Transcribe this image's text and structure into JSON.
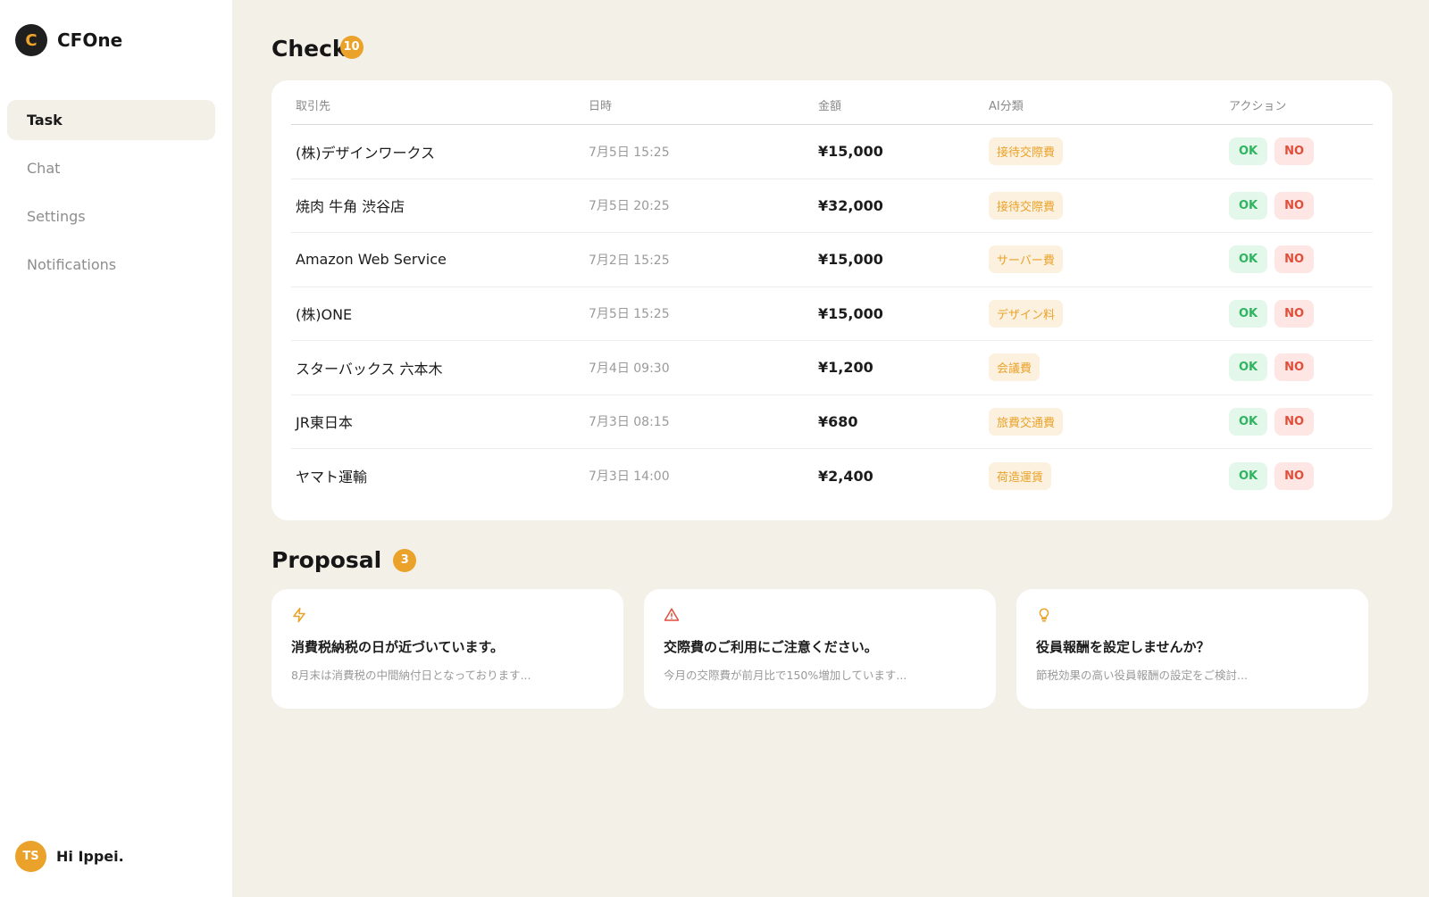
{
  "brand": {
    "logo_letter": "C",
    "name": "CFOne"
  },
  "nav": {
    "items": [
      {
        "label": "Task",
        "active": true
      },
      {
        "label": "Chat",
        "active": false
      },
      {
        "label": "Settings",
        "active": false
      },
      {
        "label": "Notifications",
        "active": false
      }
    ]
  },
  "user": {
    "initials": "TS",
    "greeting": "Hi Ippei."
  },
  "check": {
    "title": "Check",
    "count": "10",
    "columns": {
      "partner": "取引先",
      "datetime": "日時",
      "amount": "金額",
      "ai_category": "AI分類",
      "action": "アクション"
    },
    "ok_label": "OK",
    "no_label": "NO",
    "rows": [
      {
        "partner": "(株)デザインワークス",
        "datetime": "7月5日 15:25",
        "amount": "¥15,000",
        "category": "接待交際費"
      },
      {
        "partner": "焼肉 牛角 渋谷店",
        "datetime": "7月5日 20:25",
        "amount": "¥32,000",
        "category": "接待交際費"
      },
      {
        "partner": "Amazon Web Service",
        "datetime": "7月2日 15:25",
        "amount": "¥15,000",
        "category": "サーバー費"
      },
      {
        "partner": "(株)ONE",
        "datetime": "7月5日 15:25",
        "amount": "¥15,000",
        "category": "デザイン料"
      },
      {
        "partner": "スターバックス 六本木",
        "datetime": "7月4日 09:30",
        "amount": "¥1,200",
        "category": "会議費"
      },
      {
        "partner": "JR東日本",
        "datetime": "7月3日 08:15",
        "amount": "¥680",
        "category": "旅費交通費"
      },
      {
        "partner": "ヤマト運輸",
        "datetime": "7月3日 14:00",
        "amount": "¥2,400",
        "category": "荷造運賃"
      }
    ]
  },
  "proposal": {
    "title": "Proposal",
    "count": "3",
    "cards": [
      {
        "icon": "lightning-icon",
        "icon_color": "#eaa22a",
        "title": "消費税納税の日が近づいています。",
        "description": "8月末は消費税の中間納付日となっております..."
      },
      {
        "icon": "warning-icon",
        "icon_color": "#e04e3a",
        "title": "交際費のご利用にご注意ください。",
        "description": "今月の交際費が前月比で150%増加しています..."
      },
      {
        "icon": "lightbulb-icon",
        "icon_color": "#eaa22a",
        "title": "役員報酬を設定しませんか？",
        "description": "節税効果の高い役員報酬の設定をご検討..."
      }
    ]
  },
  "colors": {
    "accent": "#eaa22a",
    "background": "#f3f0e8",
    "ok_green": "#2fb45f",
    "no_red": "#e04e3a"
  }
}
